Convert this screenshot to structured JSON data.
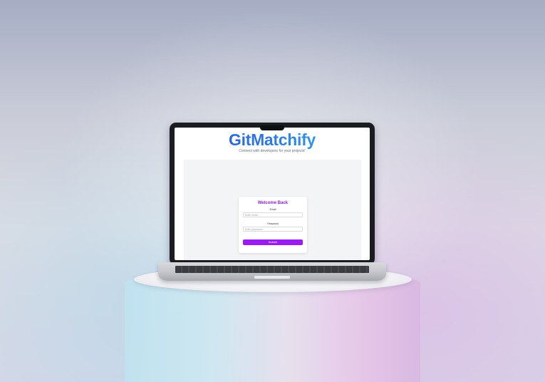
{
  "app": {
    "title": "GitMatchify",
    "subtitle": "Connect with developers for your projects!"
  },
  "login_form": {
    "heading": "Welcome Back",
    "email_label": "Email",
    "email_placeholder": "Enter email...",
    "password_label": "Password",
    "password_placeholder": "Enter password...",
    "submit_label": "Submit"
  },
  "colors": {
    "title_gradient_start": "#2f4fd8",
    "title_gradient_end": "#33b8f0",
    "heading": "#8a1fd6",
    "submit_button": "#9b1cf0"
  }
}
